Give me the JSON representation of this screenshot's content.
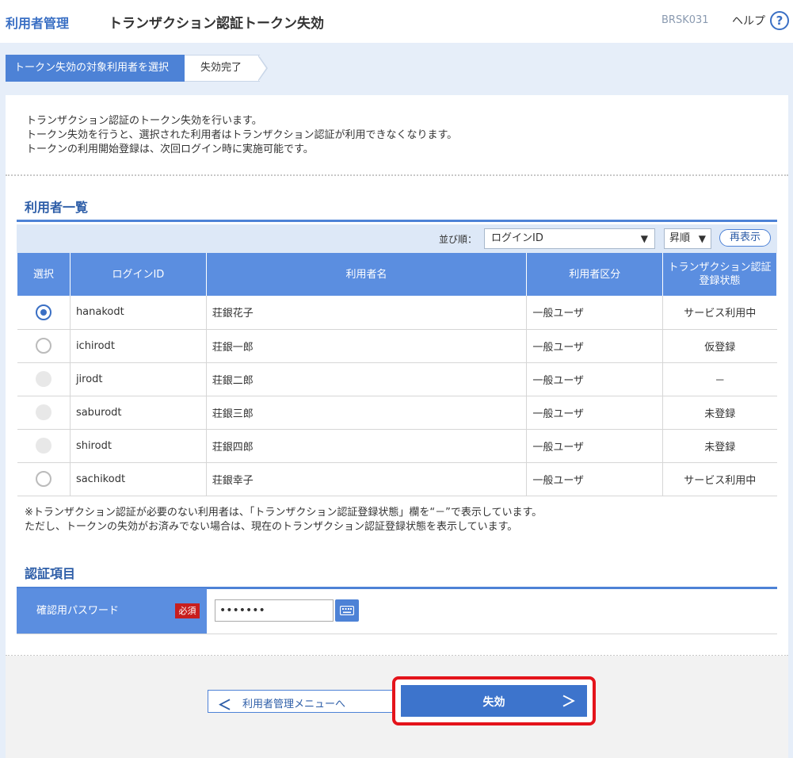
{
  "header": {
    "app_name": "利用者管理",
    "page_title": "トランザクション認証トークン失効",
    "screen_code": "BRSK031",
    "help_label": "ヘルプ",
    "help_icon": "?"
  },
  "steps": [
    {
      "label": "トークン失効の対象利用者を選択",
      "active": true
    },
    {
      "label": "失効完了",
      "active": false
    }
  ],
  "intro": [
    "トランザクション認証のトークン失効を行います。",
    "トークン失効を行うと、選択された利用者はトランザクション認証が利用できなくなります。",
    "トークンの利用開始登録は、次回ログイン時に実施可能です。"
  ],
  "users_section": {
    "title": "利用者一覧",
    "sort_label": "並び順：",
    "sort_value": "ログインID",
    "sort_caret": "▼",
    "order_value": "昇順",
    "order_caret": "▼",
    "refresh_label": "再表示",
    "columns": [
      "選択",
      "ログインID",
      "利用者名",
      "利用者区分",
      "トランザクション認証",
      "登録状態"
    ],
    "rows": [
      {
        "radio": "selected",
        "login_id": "hanakodt",
        "name": "荘銀花子",
        "type": "一般ユーザ",
        "status": "サービス利用中"
      },
      {
        "radio": "unselected",
        "login_id": "ichirodt",
        "name": "荘銀一郎",
        "type": "一般ユーザ",
        "status": "仮登録"
      },
      {
        "radio": "disabled",
        "login_id": "jirodt",
        "name": "荘銀二郎",
        "type": "一般ユーザ",
        "status": "－"
      },
      {
        "radio": "disabled",
        "login_id": "saburodt",
        "name": "荘銀三郎",
        "type": "一般ユーザ",
        "status": "未登録"
      },
      {
        "radio": "disabled",
        "login_id": "shirodt",
        "name": "荘銀四郎",
        "type": "一般ユーザ",
        "status": "未登録"
      },
      {
        "radio": "unselected",
        "login_id": "sachikodt",
        "name": "荘銀幸子",
        "type": "一般ユーザ",
        "status": "サービス利用中"
      }
    ],
    "note": [
      "※トランザクション認証が必要のない利用者は、「トランザクション認証登録状態」欄を“－”で表示しています。",
      "ただし、トークンの失効がお済みでない場合は、現在のトランザクション認証登録状態を表示しています。"
    ]
  },
  "auth_section": {
    "title": "認証項目",
    "password_label": "確認用パスワード",
    "required_badge": "必須",
    "password_value": "•••••••",
    "keyboard_icon": "keyboard-icon"
  },
  "actions": {
    "back_label": "利用者管理メニューへ",
    "back_chevron": "＜",
    "submit_label": "失効",
    "submit_chevron": "＞"
  },
  "colors": {
    "accent": "#3d74cc",
    "header_cell": "#5b8ee0",
    "highlight_border": "#e4141b",
    "required_badge": "#c81e1e"
  }
}
